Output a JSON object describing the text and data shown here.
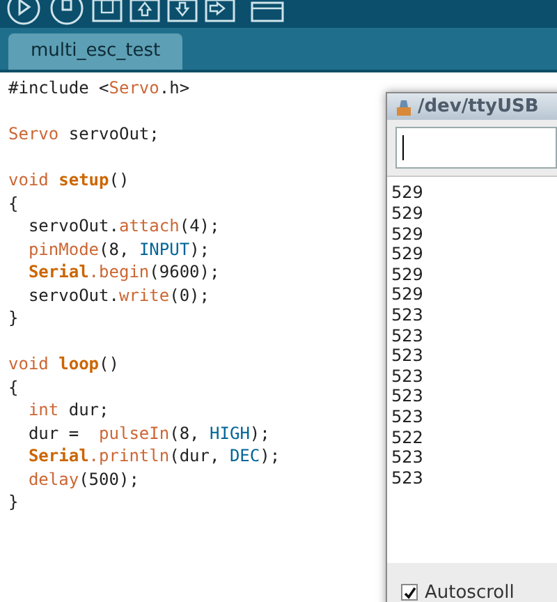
{
  "toolbar": {
    "buttons": [
      {
        "kind": "run"
      },
      {
        "kind": "stop"
      },
      {
        "kind": "new"
      },
      {
        "kind": "open"
      },
      {
        "kind": "save"
      },
      {
        "kind": "upload"
      },
      {
        "kind": "monitor"
      }
    ]
  },
  "tabs": [
    {
      "label": "multi_esc_test",
      "selected": true
    }
  ],
  "editor": {
    "lines": [
      {
        "kind": "code",
        "tokens": [
          {
            "text": "#include <",
            "kind": "plain"
          },
          {
            "text": "Servo",
            "kind": "type"
          },
          {
            "text": ".h>",
            "kind": "plain"
          }
        ]
      },
      {
        "kind": "blank"
      },
      {
        "kind": "code",
        "tokens": [
          {
            "text": "Servo",
            "kind": "type"
          },
          {
            "text": " servoOut;",
            "kind": "plain"
          }
        ]
      },
      {
        "kind": "blank"
      },
      {
        "kind": "code",
        "tokens": [
          {
            "text": "void",
            "kind": "type"
          },
          {
            "text": " setup",
            "kind": "bold"
          },
          {
            "text": "()",
            "kind": "plain"
          }
        ]
      },
      {
        "kind": "code",
        "tokens": [
          {
            "text": "{",
            "kind": "plain"
          }
        ]
      },
      {
        "kind": "code",
        "tokens": [
          {
            "text": "  servoOut.",
            "kind": "plain"
          },
          {
            "text": "attach",
            "kind": "func"
          },
          {
            "text": "(4);",
            "kind": "plain"
          }
        ]
      },
      {
        "kind": "code",
        "tokens": [
          {
            "text": "  pinMode",
            "kind": "func"
          },
          {
            "text": "(8, ",
            "kind": "plain"
          },
          {
            "text": "INPUT",
            "kind": "const"
          },
          {
            "text": ");",
            "kind": "plain"
          }
        ]
      },
      {
        "kind": "code",
        "tokens": [
          {
            "text": "  Serial",
            "kind": "bold"
          },
          {
            "text": ".begin",
            "kind": "func"
          },
          {
            "text": "(9600);",
            "kind": "plain"
          }
        ]
      },
      {
        "kind": "code",
        "tokens": [
          {
            "text": "  servoOut.",
            "kind": "plain"
          },
          {
            "text": "write",
            "kind": "func"
          },
          {
            "text": "(0);",
            "kind": "plain"
          }
        ]
      },
      {
        "kind": "code",
        "tokens": [
          {
            "text": "}",
            "kind": "plain"
          }
        ]
      },
      {
        "kind": "blank"
      },
      {
        "kind": "code",
        "tokens": [
          {
            "text": "void",
            "kind": "type"
          },
          {
            "text": " loop",
            "kind": "bold"
          },
          {
            "text": "()",
            "kind": "plain"
          }
        ]
      },
      {
        "kind": "code",
        "tokens": [
          {
            "text": "{",
            "kind": "plain"
          }
        ]
      },
      {
        "kind": "code",
        "tokens": [
          {
            "text": "  int",
            "kind": "type"
          },
          {
            "text": " dur;",
            "kind": "plain"
          }
        ]
      },
      {
        "kind": "code",
        "tokens": [
          {
            "text": "  dur =  ",
            "kind": "plain"
          },
          {
            "text": "pulseIn",
            "kind": "func"
          },
          {
            "text": "(8, ",
            "kind": "plain"
          },
          {
            "text": "HIGH",
            "kind": "const"
          },
          {
            "text": ");",
            "kind": "plain"
          }
        ]
      },
      {
        "kind": "code",
        "tokens": [
          {
            "text": "  Serial",
            "kind": "bold"
          },
          {
            "text": ".println",
            "kind": "func"
          },
          {
            "text": "(dur, ",
            "kind": "plain"
          },
          {
            "text": "DEC",
            "kind": "const"
          },
          {
            "text": ");",
            "kind": "plain"
          }
        ]
      },
      {
        "kind": "code",
        "tokens": [
          {
            "text": "  delay",
            "kind": "func"
          },
          {
            "text": "(500);",
            "kind": "plain"
          }
        ]
      },
      {
        "kind": "code",
        "tokens": [
          {
            "text": "}",
            "kind": "plain"
          }
        ]
      }
    ]
  },
  "serial_monitor": {
    "title": "/dev/ttyUSB",
    "output": [
      "529",
      "529",
      "529",
      "529",
      "529",
      "529",
      "523",
      "523",
      "523",
      "523",
      "523",
      "523",
      "522",
      "523",
      "523"
    ],
    "autoscroll": {
      "label": "Autoscroll",
      "checked": true
    }
  }
}
